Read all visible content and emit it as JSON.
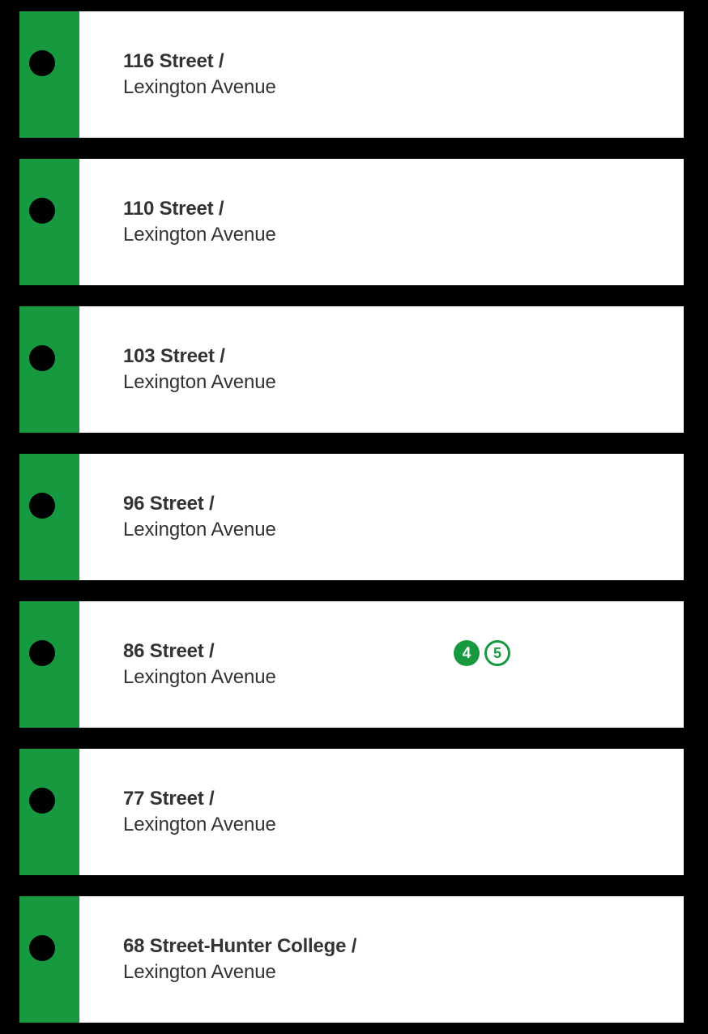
{
  "line": {
    "color": "#179a3f",
    "text_color": "#333333",
    "dot_color": "#000000"
  },
  "stations": [
    {
      "name": "116 Street /",
      "street": "Lexington Avenue",
      "transfers": []
    },
    {
      "name": "110 Street /",
      "street": "Lexington Avenue",
      "transfers": []
    },
    {
      "name": "103 Street /",
      "street": "Lexington Avenue",
      "transfers": []
    },
    {
      "name": "96 Street /",
      "street": "Lexington Avenue",
      "transfers": []
    },
    {
      "name": "86 Street /",
      "street": "Lexington Avenue",
      "transfers": [
        {
          "route": "4",
          "style": "filled",
          "color": "#179a3f"
        },
        {
          "route": "5",
          "style": "outline",
          "color": "#179a3f"
        }
      ]
    },
    {
      "name": "77 Street /",
      "street": "Lexington Avenue",
      "transfers": []
    },
    {
      "name": "68 Street-Hunter College /",
      "street": "Lexington Avenue",
      "transfers": []
    }
  ]
}
